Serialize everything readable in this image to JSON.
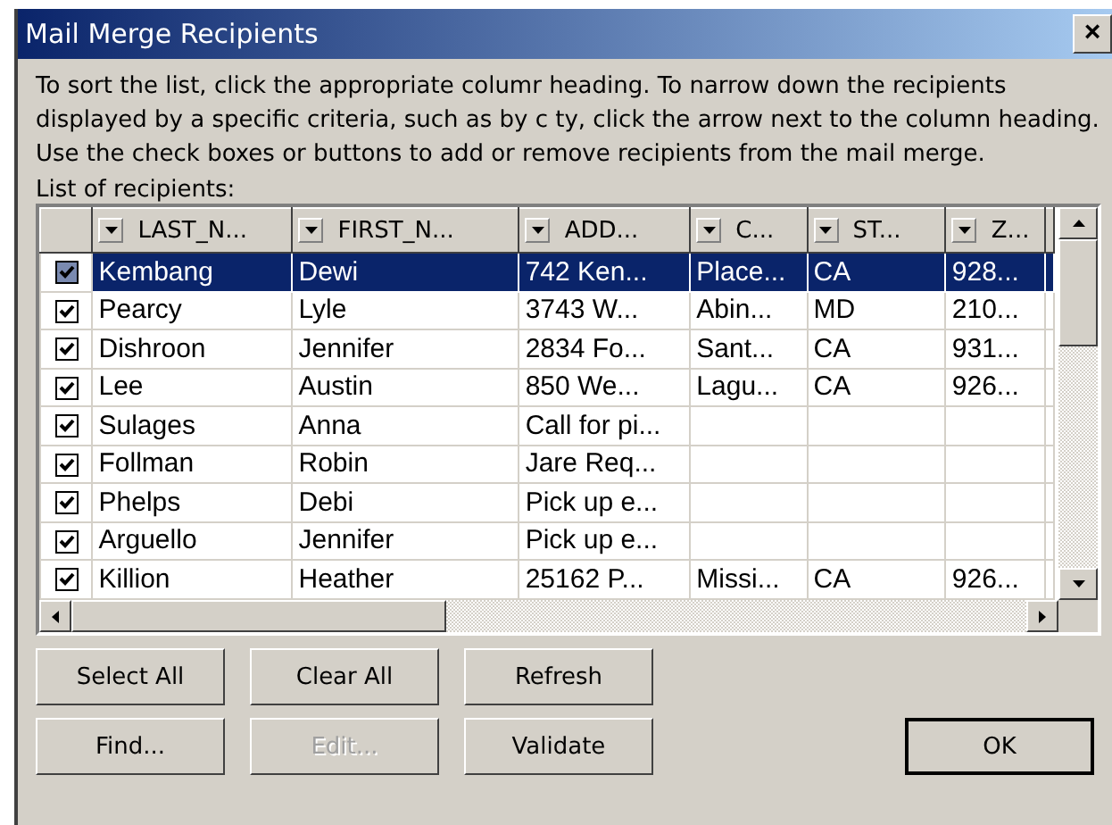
{
  "window": {
    "title": "Mail Merge Recipients",
    "close": "×"
  },
  "instructions": "To sort the list, click the appropriate columr heading.  To narrow down the recipients displayed by a specific criteria, such as by c ty, click the arrow next to the column heading.  Use the check boxes or buttons to add or remove recipients from the mail merge.",
  "list_label": "List of recipients:",
  "table": {
    "columns": [
      "LAST_N...",
      "FIRST_N...",
      "ADD...",
      "C...",
      "ST...",
      "Z..."
    ],
    "rows": [
      {
        "checked": true,
        "selected": true,
        "cells": [
          "Kembang",
          "Dewi",
          "742 Ken...",
          "Place...",
          "CA",
          "928..."
        ]
      },
      {
        "checked": true,
        "selected": false,
        "cells": [
          "Pearcy",
          "Lyle",
          "3743 W...",
          "Abin...",
          "MD",
          "210..."
        ]
      },
      {
        "checked": true,
        "selected": false,
        "cells": [
          "Dishroon",
          "Jennifer",
          "2834 Fo...",
          "Sant...",
          "CA",
          "931..."
        ]
      },
      {
        "checked": true,
        "selected": false,
        "cells": [
          "Lee",
          "Austin",
          "850 We...",
          "Lagu...",
          "CA",
          "926..."
        ]
      },
      {
        "checked": true,
        "selected": false,
        "cells": [
          "Sulages",
          "Anna",
          "Call for pi...",
          "",
          "",
          ""
        ]
      },
      {
        "checked": true,
        "selected": false,
        "cells": [
          "Follman",
          "Robin",
          "Jare Req...",
          "",
          "",
          ""
        ]
      },
      {
        "checked": true,
        "selected": false,
        "cells": [
          "Phelps",
          "Debi",
          "Pick up e...",
          "",
          "",
          ""
        ]
      },
      {
        "checked": true,
        "selected": false,
        "cells": [
          "Arguello",
          "Jennifer",
          "Pick up e...",
          "",
          "",
          ""
        ]
      },
      {
        "checked": true,
        "selected": false,
        "cells": [
          "Killion",
          "Heather",
          "25162 P...",
          "Missi...",
          "CA",
          "926..."
        ]
      }
    ]
  },
  "buttons": [
    {
      "label": "Select All",
      "disabled": false
    },
    {
      "label": "Clear All",
      "disabled": false
    },
    {
      "label": "Refresh",
      "disabled": false
    },
    {
      "label": "Find...",
      "disabled": false
    },
    {
      "label": "Edit...",
      "disabled": true
    },
    {
      "label": "Validate",
      "disabled": false
    }
  ],
  "ok_button": "OK"
}
